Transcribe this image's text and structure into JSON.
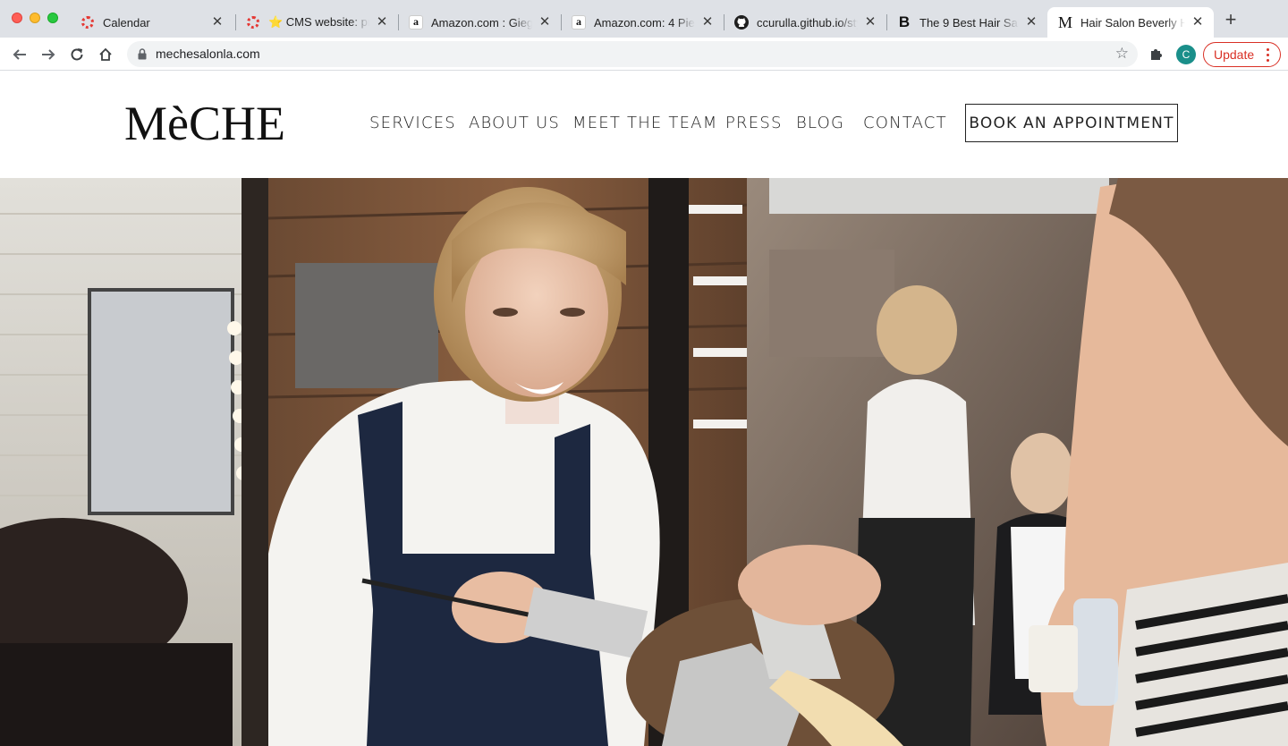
{
  "browser": {
    "tabs": [
      {
        "title": "Calendar",
        "favicon": "calendar-icon"
      },
      {
        "title": "⭐ CMS website: pro",
        "favicon": "ring-icon"
      },
      {
        "title": "Amazon.com : Giegx",
        "favicon": "amazon-icon"
      },
      {
        "title": "Amazon.com: 4 Piece",
        "favicon": "amazon-icon"
      },
      {
        "title": "ccurulla.github.io/sty",
        "favicon": "github-icon"
      },
      {
        "title": "The 9 Best Hair Salo",
        "favicon": "b-icon"
      },
      {
        "title": "Hair Salon Beverly Hi",
        "favicon": "m-icon"
      }
    ],
    "url": "mechesalonla.com",
    "profile_initial": "C",
    "update_label": "Update"
  },
  "site": {
    "logo": "MèCHE",
    "nav": {
      "services": "SERVICES",
      "about": "ABOUT US",
      "team": "MEET THE TEAM",
      "press": "PRESS",
      "blog": "BLOG",
      "contact": "CONTACT"
    },
    "book_label": "BOOK AN APPOINTMENT"
  },
  "colors": {
    "tabbar": "#dee1e6",
    "update_red": "#d93025",
    "text_dark": "#222222"
  }
}
